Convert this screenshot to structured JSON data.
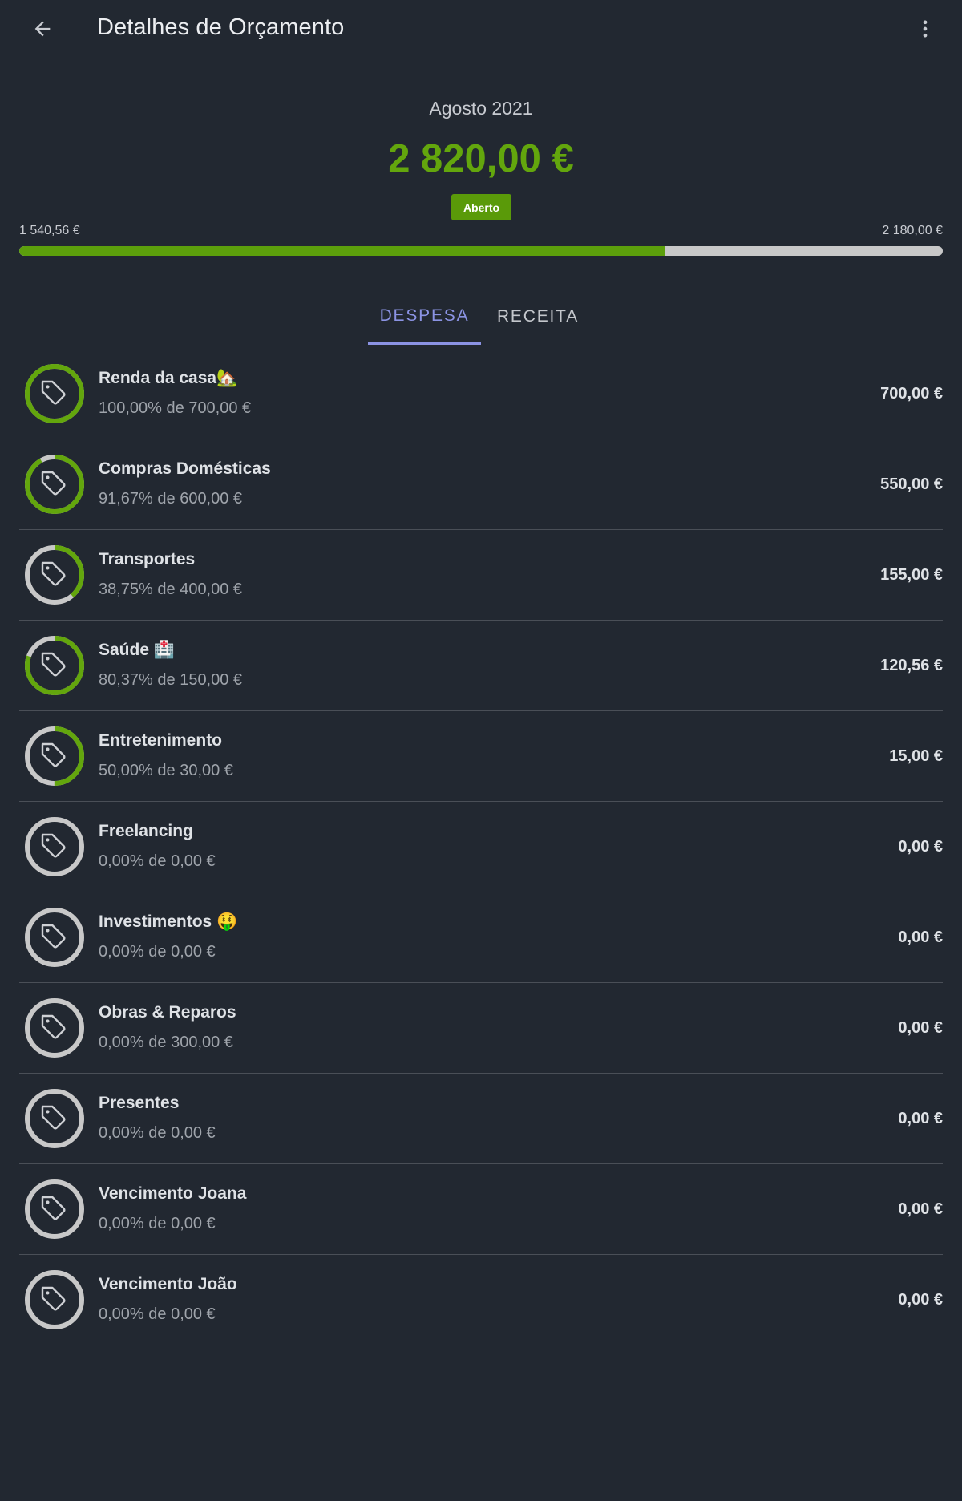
{
  "header": {
    "title": "Detalhes de Orçamento",
    "back_icon": "arrow-left-icon",
    "more_icon": "more-vert-icon"
  },
  "summary": {
    "period": "Agosto 2021",
    "total": "2 820,00 €",
    "status": "Aberto",
    "range_min": "1 540,56 €",
    "range_max": "2 180,00 €",
    "progress_fraction": 0.7
  },
  "colors": {
    "accent_green": "#63a60d",
    "tab_active": "#8b93e3",
    "background": "#222831",
    "ring_track": "#c8c8c8"
  },
  "tabs": [
    {
      "label": "DESPESA",
      "active": true
    },
    {
      "label": "RECEITA",
      "active": false
    }
  ],
  "categories": [
    {
      "name": "Renda da casa🏡",
      "sub": "100,00% de 700,00 €",
      "amount": "700,00 €",
      "fraction": 1.0,
      "icon": "tag-icon"
    },
    {
      "name": "Compras Domésticas",
      "sub": "91,67% de 600,00 €",
      "amount": "550,00 €",
      "fraction": 0.9167,
      "icon": "tag-icon"
    },
    {
      "name": "Transportes",
      "sub": "38,75% de 400,00 €",
      "amount": "155,00 €",
      "fraction": 0.3875,
      "icon": "tag-icon"
    },
    {
      "name": "Saúde 🏥",
      "sub": "80,37% de 150,00 €",
      "amount": "120,56 €",
      "fraction": 0.8037,
      "icon": "tag-icon"
    },
    {
      "name": "Entretenimento",
      "sub": "50,00% de 30,00 €",
      "amount": "15,00 €",
      "fraction": 0.5,
      "icon": "tag-icon"
    },
    {
      "name": "Freelancing",
      "sub": "0,00% de 0,00 €",
      "amount": "0,00 €",
      "fraction": 0,
      "icon": "tag-icon"
    },
    {
      "name": "Investimentos 🤑",
      "sub": "0,00% de 0,00 €",
      "amount": "0,00 €",
      "fraction": 0,
      "icon": "tag-icon"
    },
    {
      "name": "Obras & Reparos",
      "sub": "0,00% de 300,00 €",
      "amount": "0,00 €",
      "fraction": 0,
      "icon": "tag-icon"
    },
    {
      "name": "Presentes",
      "sub": "0,00% de 0,00 €",
      "amount": "0,00 €",
      "fraction": 0,
      "icon": "tag-icon"
    },
    {
      "name": "Vencimento Joana",
      "sub": "0,00% de 0,00 €",
      "amount": "0,00 €",
      "fraction": 0,
      "icon": "tag-icon"
    },
    {
      "name": "Vencimento João",
      "sub": "0,00% de 0,00 €",
      "amount": "0,00 €",
      "fraction": 0,
      "icon": "tag-icon"
    }
  ]
}
